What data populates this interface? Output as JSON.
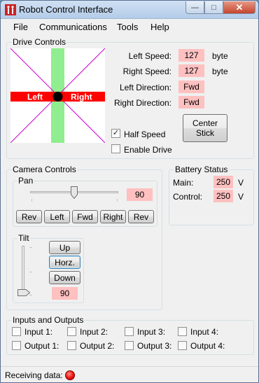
{
  "window": {
    "title": "Robot Control Interface",
    "close_glyph": "✕",
    "min_glyph": "—",
    "max_glyph": "□"
  },
  "menu": {
    "file": "File",
    "communications": "Communications",
    "tools": "Tools",
    "help": "Help"
  },
  "drive": {
    "group_label": "Drive Controls",
    "left_label": "Left",
    "right_label": "Right",
    "left_speed_label": "Left Speed:",
    "left_speed_value": "127",
    "right_speed_label": "Right Speed:",
    "right_speed_value": "127",
    "left_direction_label": "Left Direction:",
    "left_direction_value": "Fwd",
    "right_direction_label": "Right Direction:",
    "right_direction_value": "Fwd",
    "unit": "byte",
    "half_speed_label": "Half Speed",
    "half_speed_checked": true,
    "enable_drive_label": "Enable Drive",
    "enable_drive_checked": false,
    "center_stick_line1": "Center",
    "center_stick_line2": "Stick"
  },
  "camera": {
    "group_label": "Camera Controls",
    "pan_label": "Pan",
    "pan_value": "90",
    "pan_slider_fraction": 0.5,
    "pan_buttons": [
      "Rev",
      "Left",
      "Fwd",
      "Right",
      "Rev"
    ],
    "tilt_label": "Tilt",
    "tilt_value": "90",
    "tilt_slider_fraction": 0.0,
    "up_label": "Up",
    "horz_label": "Horz.",
    "down_label": "Down"
  },
  "battery": {
    "group_label": "Battery Status",
    "main_label": "Main:",
    "main_value": "250",
    "control_label": "Control:",
    "control_value": "250",
    "unit": "V"
  },
  "io": {
    "group_label": "Inputs and Outputs",
    "inputs": [
      "Input 1:",
      "Input 2:",
      "Input 3:",
      "Input 4:"
    ],
    "outputs": [
      "Output 1:",
      "Output 2:",
      "Output 3:",
      "Output 4:"
    ]
  },
  "status": {
    "receiving_label": "Receiving data:",
    "led_color": "#ee1111"
  },
  "colors": {
    "value_bg": "#ffc0c0",
    "stick_bar": "#ff0000",
    "stick_vertical": "#90ee90",
    "diagonal": "#cc00cc"
  }
}
